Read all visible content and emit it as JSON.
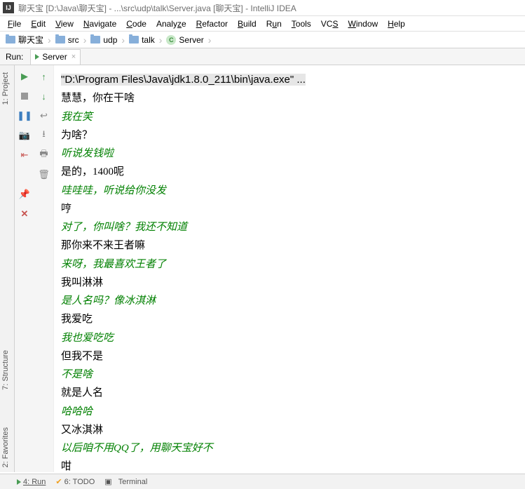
{
  "title_bar": {
    "text": "聊天宝 [D:\\Java\\聊天宝] - ...\\src\\udp\\talk\\Server.java [聊天宝] - IntelliJ IDEA"
  },
  "menu": {
    "items": [
      "File",
      "Edit",
      "View",
      "Navigate",
      "Code",
      "Analyze",
      "Refactor",
      "Build",
      "Run",
      "Tools",
      "VCS",
      "Window",
      "Help"
    ]
  },
  "breadcrumb": {
    "items": [
      {
        "icon": "folder",
        "label": "聊天宝"
      },
      {
        "icon": "folder",
        "label": "src"
      },
      {
        "icon": "folder",
        "label": "udp"
      },
      {
        "icon": "folder",
        "label": "talk"
      },
      {
        "icon": "class",
        "label": "Server"
      }
    ]
  },
  "run_tabs": {
    "label": "Run:",
    "tab": {
      "name": "Server"
    }
  },
  "left_tabs": {
    "project": "1: Project",
    "structure": "7: Structure",
    "favorites": "2: Favorites"
  },
  "console": {
    "cmd_line": "\"D:\\Program Files\\Java\\jdk1.8.0_211\\bin\\java.exe\" ...",
    "lines": [
      {
        "t": "in",
        "text": "慧慧，你在干啥"
      },
      {
        "t": "out",
        "text": "我在笑"
      },
      {
        "t": "in",
        "text": "为啥？"
      },
      {
        "t": "out",
        "text": "听说发钱啦"
      },
      {
        "t": "in",
        "text": "是的，1400呢"
      },
      {
        "t": "out",
        "text": "哇哇哇，听说给你没发"
      },
      {
        "t": "in",
        "text": "哼"
      },
      {
        "t": "out",
        "text": "对了，你叫啥？我还不知道"
      },
      {
        "t": "in",
        "text": "那你来不来王者嘛"
      },
      {
        "t": "out",
        "text": "来呀，我最喜欢王者了"
      },
      {
        "t": "in",
        "text": "我叫淋淋"
      },
      {
        "t": "out",
        "text": "是人名吗？像冰淇淋"
      },
      {
        "t": "in",
        "text": "我爱吃"
      },
      {
        "t": "out",
        "text": "我也爱吃吃"
      },
      {
        "t": "in",
        "text": "但我不是"
      },
      {
        "t": "out",
        "text": "不是啥"
      },
      {
        "t": "in",
        "text": "就是人名"
      },
      {
        "t": "out",
        "text": "哈哈哈"
      },
      {
        "t": "in",
        "text": "又冰淇淋"
      },
      {
        "t": "out",
        "text": "以后咱不用QQ了，用聊天宝好不"
      },
      {
        "t": "in",
        "text": "咁"
      }
    ]
  },
  "bottom_tabs": {
    "run": "4: Run",
    "todo": "6: TODO",
    "terminal": "Terminal"
  }
}
